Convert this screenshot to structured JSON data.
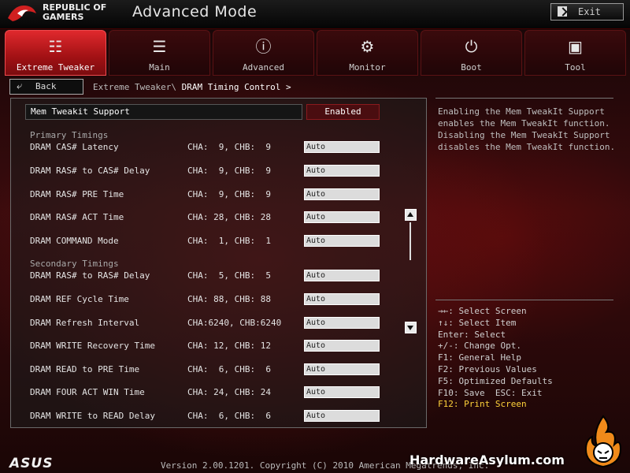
{
  "brand": {
    "line1": "REPUBLIC OF",
    "line2": "GAMERS"
  },
  "title": "Advanced Mode",
  "exit_label": "Exit",
  "tabs": [
    {
      "label": "Extreme Tweaker",
      "icon": "extreme-tweaker-icon",
      "active": true
    },
    {
      "label": "Main",
      "icon": "main-list-icon",
      "active": false
    },
    {
      "label": "Advanced",
      "icon": "advanced-info-icon",
      "active": false
    },
    {
      "label": "Monitor",
      "icon": "monitor-gauge-icon",
      "active": false
    },
    {
      "label": "Boot",
      "icon": "power-icon",
      "active": false
    },
    {
      "label": "Tool",
      "icon": "toolbox-icon",
      "active": false
    }
  ],
  "back_label": "Back",
  "breadcrumb": {
    "parent": "Extreme Tweaker\\",
    "current": "DRAM Timing Control >"
  },
  "mem_tweakit": {
    "label": "Mem Tweakit Support",
    "value": "Enabled"
  },
  "primary_heading": "Primary Timings",
  "secondary_heading": "Secondary Timings",
  "primary": [
    {
      "label": "DRAM CAS# Latency",
      "value": "CHA:  9, CHB:  9",
      "field": "Auto"
    },
    {
      "label": "DRAM RAS# to CAS# Delay",
      "value": "CHA:  9, CHB:  9",
      "field": "Auto"
    },
    {
      "label": "DRAM RAS# PRE Time",
      "value": "CHA:  9, CHB:  9",
      "field": "Auto"
    },
    {
      "label": "DRAM RAS# ACT Time",
      "value": "CHA: 28, CHB: 28",
      "field": "Auto"
    },
    {
      "label": "DRAM COMMAND Mode",
      "value": "CHA:  1, CHB:  1",
      "field": "Auto"
    }
  ],
  "secondary": [
    {
      "label": "DRAM RAS# to RAS# Delay",
      "value": "CHA:  5, CHB:  5",
      "field": "Auto"
    },
    {
      "label": "DRAM REF Cycle Time",
      "value": "CHA: 88, CHB: 88",
      "field": "Auto"
    },
    {
      "label": "DRAM Refresh Interval",
      "value": "CHA:6240, CHB:6240",
      "field": "Auto"
    },
    {
      "label": "DRAM WRITE Recovery Time",
      "value": "CHA: 12, CHB: 12",
      "field": "Auto"
    },
    {
      "label": "DRAM READ to PRE Time",
      "value": "CHA:  6, CHB:  6",
      "field": "Auto"
    },
    {
      "label": "DRAM FOUR ACT WIN Time",
      "value": "CHA: 24, CHB: 24",
      "field": "Auto"
    },
    {
      "label": "DRAM WRITE to READ Delay",
      "value": "CHA:  6, CHB:  6",
      "field": "Auto"
    }
  ],
  "help_text": "Enabling the Mem TweakIt Support enables the Mem TweakIt function. Disabling the Mem TweakIt Support disables the Mem TweakIt function.",
  "keys": [
    "→←: Select Screen",
    "↑↓: Select Item",
    "Enter: Select",
    "+/-: Change Opt.",
    "F1: General Help",
    "F2: Previous Values",
    "F5: Optimized Defaults",
    "F10: Save  ESC: Exit",
    "F12: Print Screen"
  ],
  "footer": {
    "asus": "ASUS",
    "version": "Version 2.00.1201. Copyright (C) 2010 American Megatrends, Inc.",
    "watermark": "HardwareAsylum.com"
  },
  "colors": {
    "accent": "#d8262a",
    "highlight": "#ffd23a"
  }
}
